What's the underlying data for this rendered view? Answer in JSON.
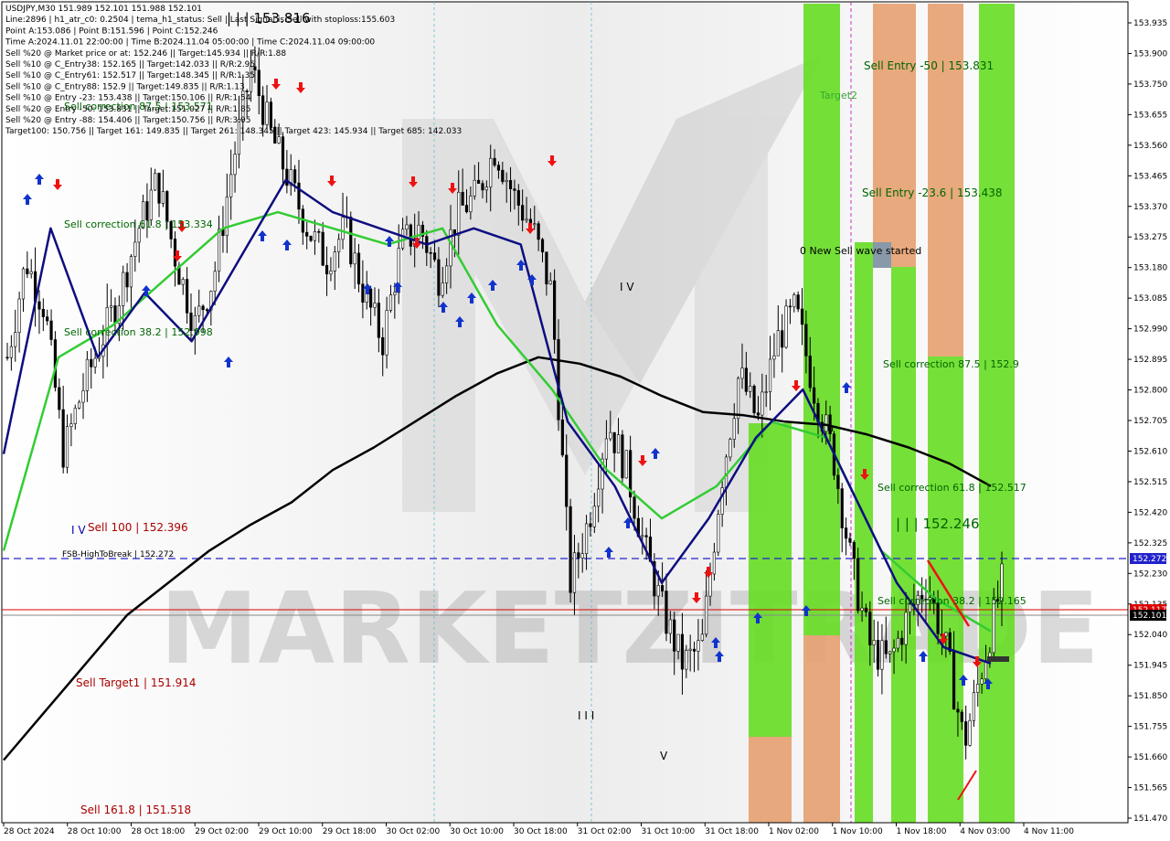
{
  "info": {
    "lines": [
      "USDJPY,M30   151.989 152.101 151.988 152.101",
      "Line:2896  |  h1_atr_c0: 0.2504  |  tema_h1_status: Sell  |  Last Signal is:Sell with stoploss:155.603",
      "Point A:153.086  |  Point B:151.596  |  Point C:152.246",
      "Time A:2024.11.01 22:00:00  |  Time B:2024.11.04 05:00:00  |  Time C:2024.11.04 09:00:00",
      "Sell %20 @ Market price or at: 152.246  ||  Target:145.934  ||  R/R:1.88",
      "Sell %10 @ C_Entry38: 152.165  ||  Target:142.033  ||  R/R:2.95",
      "Sell %10 @ C_Entry61: 152.517  ||  Target:148.345  ||  R/R:1.35",
      "Sell %10 @ C_Entry88: 152.9  ||  Target:149.835  ||  R/R:1.13",
      "Sell %10 @ Entry -23: 153.438  ||  Target:150.106  ||  R/R:1.54",
      "Sell %20 @ Entry -50: 153.831  ||  Target:151.027  ||  R/R:1.85",
      "Sell %20 @ Entry -88: 154.406  ||  Target:150.756  ||  R/R:3.05",
      "Target100: 150.756  ||  Target 161: 149.835  ||  Target 261: 148.345  ||  Target 423: 145.934  ||  Target 685: 142.033"
    ]
  },
  "watermark": "MARKETZITRADE",
  "colors": {
    "zone_green": "#66dd22",
    "zone_orange": "#e6a070",
    "zone_grey": "#8899aa",
    "buy_arrow": "#1133cc",
    "sell_arrow": "#ee1111",
    "line_black": "#000000",
    "line_navy": "#0d0d80",
    "line_green": "#33cc33",
    "dashed_blue": "#2222cc",
    "red_line": "#dd0000",
    "price_tag": "#000000"
  },
  "labels": {
    "top_wave": "| | | 153.816",
    "sell_entry_50": "Sell Entry -50 | 153.831",
    "target2": "Target2",
    "sell_entry_23": "Sell Entry -23.6 | 153.438",
    "new_sell_wave": "0 New Sell wave started",
    "sell_corr_875": "Sell correction 87.5 | 152.9",
    "sell_corr_618_right": "Sell correction 61.8 | 152.517",
    "wave_c": "| | | 152.246",
    "sell_corr_382_right": "Sell correction 38.2 | 152.165",
    "sell_corr_618_left": "Sell correction 61.8 | 153.334",
    "sell_corr_382_left": "Sell correction 38.2 | 152.998",
    "sell_corr_875_left": "Sell correction 87.5 | 153.571",
    "sell_100": "Sell 100 | 152.396",
    "fsb": "FSB-HighToBreak | 152.272",
    "sell_target1": "Sell Target1 | 151.914",
    "sell_1618": "Sell 161.8 | 151.518",
    "wave_iv_left": "I V",
    "wave_iv_mid": "I V",
    "wave_iii": "I I I",
    "wave_v": "V",
    "wave_0": "0"
  },
  "price_tags": {
    "dashed": "152.272",
    "red": "152.117",
    "current": "152.101"
  },
  "chart_data": {
    "type": "candlestick",
    "symbol": "USDJPY",
    "timeframe": "M30",
    "ylim": [
      151.47,
      153.98
    ],
    "y_ticks": [
      "153.935",
      "153.900",
      "153.750",
      "153.655",
      "153.560",
      "153.465",
      "153.370",
      "153.275",
      "153.180",
      "153.085",
      "152.990",
      "152.895",
      "152.800",
      "152.705",
      "152.610",
      "152.515",
      "152.420",
      "152.325",
      "152.230",
      "152.135",
      "152.040",
      "151.945",
      "151.850",
      "151.755",
      "151.660",
      "151.565",
      "151.470"
    ],
    "x_ticks": [
      "28 Oct 2024",
      "28 Oct 10:00",
      "28 Oct 18:00",
      "29 Oct 02:00",
      "29 Oct 10:00",
      "29 Oct 18:00",
      "30 Oct 02:00",
      "30 Oct 10:00",
      "30 Oct 18:00",
      "31 Oct 02:00",
      "31 Oct 10:00",
      "31 Oct 18:00",
      "1 Nov 02:00",
      "1 Nov 10:00",
      "1 Nov 18:00",
      "4 Nov 03:00",
      "4 Nov 11:00"
    ],
    "series": [
      {
        "name": "close",
        "values": [
          152.9,
          153.2,
          153.05,
          152.6,
          152.8,
          152.95,
          153.1,
          153.3,
          153.45,
          153.2,
          153.0,
          153.15,
          153.5,
          153.8,
          153.6,
          153.45,
          153.3,
          153.2,
          153.3,
          153.1,
          152.95,
          153.25,
          153.3,
          153.15,
          153.35,
          153.4,
          153.55,
          153.4,
          153.3,
          153.1,
          152.2,
          152.4,
          152.7,
          152.55,
          152.3,
          152.1,
          151.95,
          152.0,
          152.5,
          152.85,
          152.7,
          152.95,
          153.05,
          152.8,
          152.6,
          152.25,
          152.0,
          151.95,
          152.1,
          152.2,
          152.0,
          151.7,
          151.95,
          152.2
        ]
      },
      {
        "name": "MA black",
        "values": [
          151.65,
          151.8,
          151.95,
          152.1,
          152.2,
          152.3,
          152.38,
          152.45,
          152.55,
          152.62,
          152.7,
          152.78,
          152.85,
          152.9,
          152.88,
          152.84,
          152.78,
          152.73,
          152.72,
          152.7,
          152.69,
          152.66,
          152.62,
          152.57,
          152.5
        ]
      },
      {
        "name": "MA navy",
        "values": [
          152.6,
          153.3,
          152.9,
          153.1,
          152.95,
          153.2,
          153.45,
          153.35,
          153.3,
          153.25,
          153.3,
          153.25,
          152.7,
          152.5,
          152.2,
          152.4,
          152.65,
          152.8,
          152.5,
          152.2,
          152.0,
          151.95
        ]
      },
      {
        "name": "MA green",
        "values": [
          152.3,
          152.9,
          153.0,
          153.15,
          153.3,
          153.35,
          153.3,
          153.25,
          153.3,
          153.0,
          152.8,
          152.55,
          152.4,
          152.5,
          152.7,
          152.65,
          152.3,
          152.15,
          152.05
        ]
      }
    ]
  }
}
